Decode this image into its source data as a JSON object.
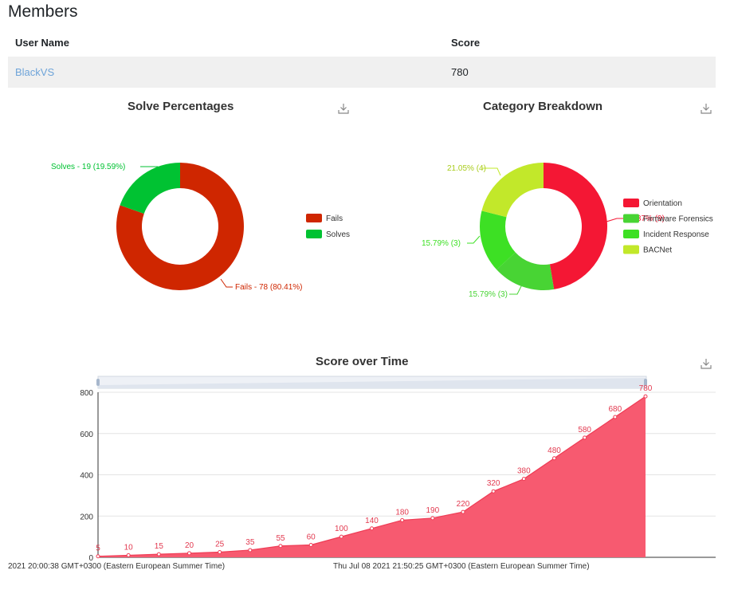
{
  "page": {
    "title": "Members"
  },
  "members_table": {
    "headers": [
      "User Name",
      "Score"
    ],
    "rows": [
      {
        "user": "BlackVS",
        "score": "780"
      }
    ]
  },
  "icons": {
    "download": "download-icon"
  },
  "colors": {
    "fails": "#cf2600",
    "solves": "#00c232",
    "orientation": "#f41734",
    "firmware": "#48d434",
    "incident": "#3de024",
    "bacnet": "#c2e82a",
    "area": "#f75a70",
    "area_line": "#ef3c55"
  },
  "charts": {
    "solve": {
      "title": "Solve Percentages",
      "legend": [
        "Fails",
        "Solves"
      ],
      "labels": {
        "solves": "Solves - 19 (19.59%)",
        "fails": "Fails - 78 (80.41%)"
      }
    },
    "category": {
      "title": "Category Breakdown",
      "legend": [
        "Orientation",
        "Firmware Forensics",
        "Incident Response",
        "BACNet"
      ],
      "labels": {
        "bacnet": "21.05% (4)",
        "incident": "15.79% (3)",
        "firmware": "15.79% (3)",
        "orientation": "47.37% (9)"
      }
    },
    "score": {
      "title": "Score over Time",
      "x_left_label": "2021 20:00:38 GMT+0300 (Eastern European Summer Time)",
      "x_mid_label": "Thu Jul 08 2021 21:50:25 GMT+0300 (Eastern European Summer Time)"
    }
  },
  "chart_data": [
    {
      "type": "pie",
      "title": "Solve Percentages",
      "categories": [
        "Fails",
        "Solves"
      ],
      "values": [
        78,
        19
      ],
      "percent": [
        80.41,
        19.59
      ]
    },
    {
      "type": "pie",
      "title": "Category Breakdown",
      "categories": [
        "Orientation",
        "Firmware Forensics",
        "Incident Response",
        "BACNet"
      ],
      "values": [
        9,
        3,
        3,
        4
      ],
      "percent": [
        47.37,
        15.79,
        15.79,
        21.05
      ]
    },
    {
      "type": "area",
      "title": "Score over Time",
      "values": [
        5,
        10,
        15,
        20,
        25,
        35,
        55,
        60,
        100,
        140,
        180,
        190,
        220,
        320,
        380,
        480,
        580,
        680,
        780
      ],
      "ylim": [
        0,
        800
      ],
      "yticks": [
        0,
        200,
        400,
        600,
        800
      ]
    }
  ]
}
